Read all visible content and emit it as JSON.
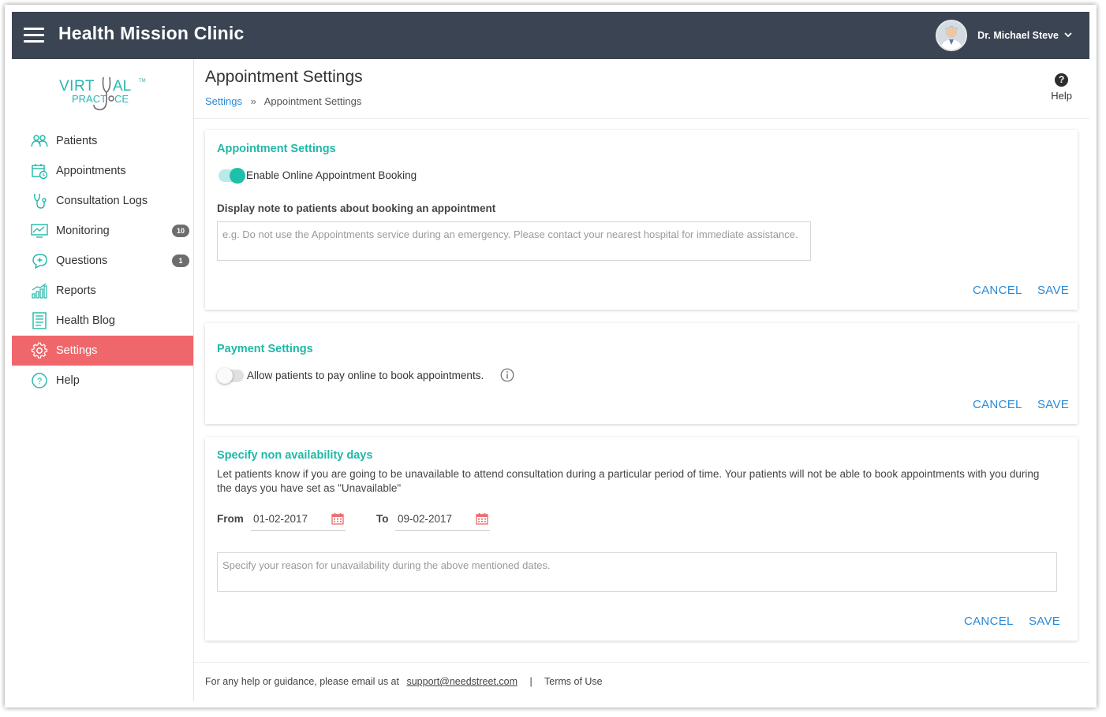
{
  "app": {
    "title": "Health Mission Clinic"
  },
  "user": {
    "name": "Dr. Michael Steve"
  },
  "logo": {
    "line1": "VIRTUAL",
    "line2": "PRACTICE",
    "tm": "TM"
  },
  "sidebar": {
    "items": [
      {
        "label": "Patients",
        "icon": "patients-icon"
      },
      {
        "label": "Appointments",
        "icon": "appointments-icon"
      },
      {
        "label": "Consultation Logs",
        "icon": "stethoscope-icon"
      },
      {
        "label": "Monitoring",
        "icon": "monitoring-icon",
        "badge": "10"
      },
      {
        "label": "Questions",
        "icon": "questions-icon",
        "badge": "1"
      },
      {
        "label": "Reports",
        "icon": "reports-icon"
      },
      {
        "label": "Health Blog",
        "icon": "blog-icon"
      },
      {
        "label": "Settings",
        "icon": "settings-icon",
        "active": true
      },
      {
        "label": "Help",
        "icon": "help-icon"
      }
    ]
  },
  "header": {
    "title": "Appointment Settings",
    "breadcrumb": {
      "link": "Settings",
      "separator": "»",
      "current": "Appointment Settings"
    },
    "help_label": "Help"
  },
  "appointment_card": {
    "title": "Appointment Settings",
    "toggle_label": "Enable Online Appointment Booking",
    "toggle_on": true,
    "note_label": "Display note to patients about booking an appointment",
    "note_placeholder": "e.g. Do not use the Appointments service during an emergency. Please contact your nearest hospital for immediate assistance.",
    "cancel": "CANCEL",
    "save": "SAVE"
  },
  "payment_card": {
    "title": "Payment Settings",
    "toggle_label": "Allow patients to pay online to book appointments.",
    "toggle_on": false,
    "cancel": "CANCEL",
    "save": "SAVE"
  },
  "availability_card": {
    "title": "Specify non availability days",
    "description": "Let patients know if you are going to be unavailable to attend consultation during a particular period of time. Your patients will not be able to book appointments with you during the days you have set as \"Unavailable\"",
    "from_label": "From",
    "from_value": "01-02-2017",
    "to_label": "To",
    "to_value": "09-02-2017",
    "reason_placeholder": "Specify your reason for unavailability during the above mentioned dates.",
    "cancel": "CANCEL",
    "save": "SAVE"
  },
  "footer": {
    "text": "For any help or guidance, please email us at",
    "email": "support@needstreet.com",
    "separator": "|",
    "terms": "Terms of Use"
  },
  "colors": {
    "topbar": "#3b4452",
    "accent_teal": "#1fb8a8",
    "active_nav": "#f0676b",
    "link_blue": "#2a8ad8",
    "calendar_red": "#f0676b"
  }
}
